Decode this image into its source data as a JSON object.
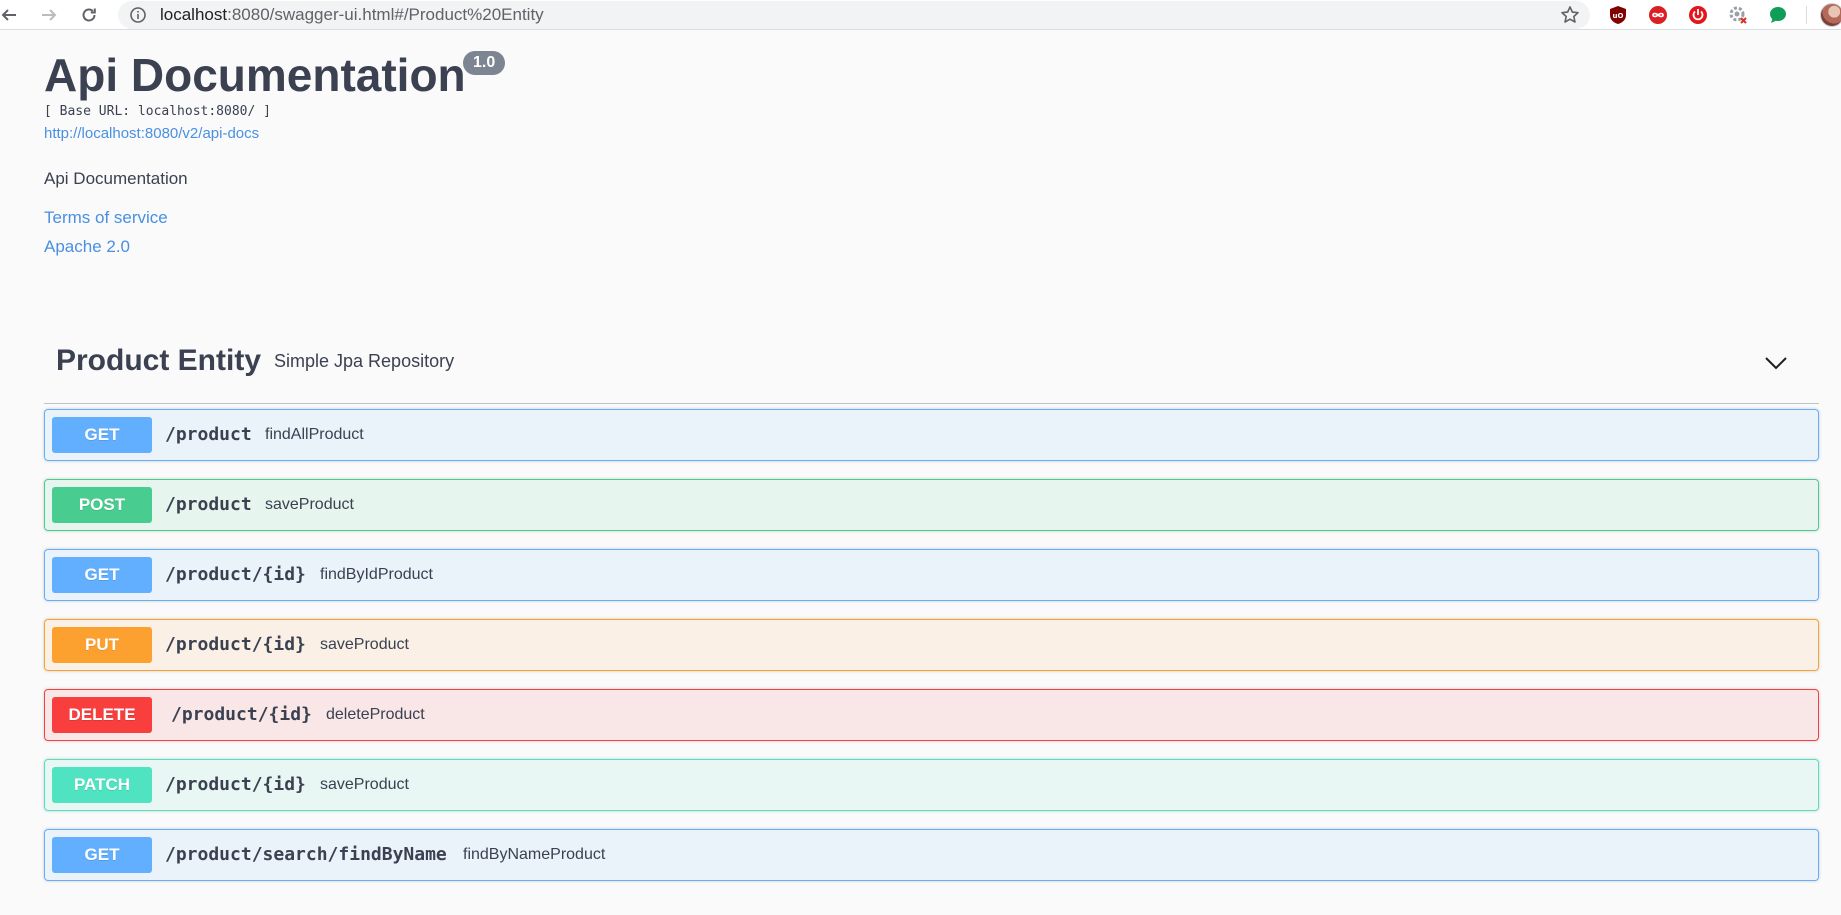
{
  "browser": {
    "url_host": "localhost",
    "url_rest": ":8080/swagger-ui.html#/Product%20Entity"
  },
  "info": {
    "title": "Api Documentation",
    "version": "1.0",
    "base_url": "[ Base URL: localhost:8080/ ]",
    "api_docs_link": "http://localhost:8080/v2/api-docs",
    "description": "Api Documentation",
    "terms_of_service": "Terms of service",
    "license": "Apache 2.0"
  },
  "tag": {
    "name": "Product Entity",
    "description": "Simple Jpa Repository"
  },
  "colors": {
    "get": "#61affe",
    "post": "#49cc90",
    "put": "#fca130",
    "delete": "#f93e3e",
    "patch": "#50e3c2",
    "link": "#4990e2",
    "text": "#3b4151"
  },
  "operations": [
    {
      "method": "GET",
      "path": "/product",
      "summary": "findAllProduct"
    },
    {
      "method": "POST",
      "path": "/product",
      "summary": "saveProduct"
    },
    {
      "method": "GET",
      "path": "/product/{id}",
      "summary": "findByIdProduct"
    },
    {
      "method": "PUT",
      "path": "/product/{id}",
      "summary": "saveProduct"
    },
    {
      "method": "DELETE",
      "path": "/product/{id}",
      "summary": "deleteProduct"
    },
    {
      "method": "PATCH",
      "path": "/product/{id}",
      "summary": "saveProduct"
    },
    {
      "method": "GET",
      "path": "/product/search/findByName",
      "summary": "findByNameProduct"
    }
  ]
}
